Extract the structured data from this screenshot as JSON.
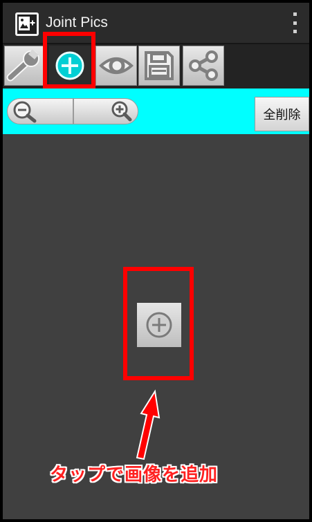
{
  "app": {
    "title": "Joint Pics"
  },
  "toolbar": {
    "items": [
      {
        "name": "settings",
        "icon": "wrench-icon"
      },
      {
        "name": "add",
        "icon": "plus-circle-icon",
        "active": true
      },
      {
        "name": "preview",
        "icon": "eye-icon"
      },
      {
        "name": "save",
        "icon": "floppy-disk-icon"
      },
      {
        "name": "share",
        "icon": "share-icon"
      }
    ]
  },
  "zoom": {
    "out_icon": "zoom-out-icon",
    "in_icon": "zoom-in-icon"
  },
  "actions": {
    "clear_all_label": "全削除"
  },
  "canvas": {
    "add_icon": "plus-circle-icon"
  },
  "annotation": {
    "text": "タップで画像を追加",
    "color": "#ff0000"
  },
  "colors": {
    "zoombar_bg": "#00ffff",
    "accent": "#00e5e5",
    "highlight": "#ff0000"
  }
}
